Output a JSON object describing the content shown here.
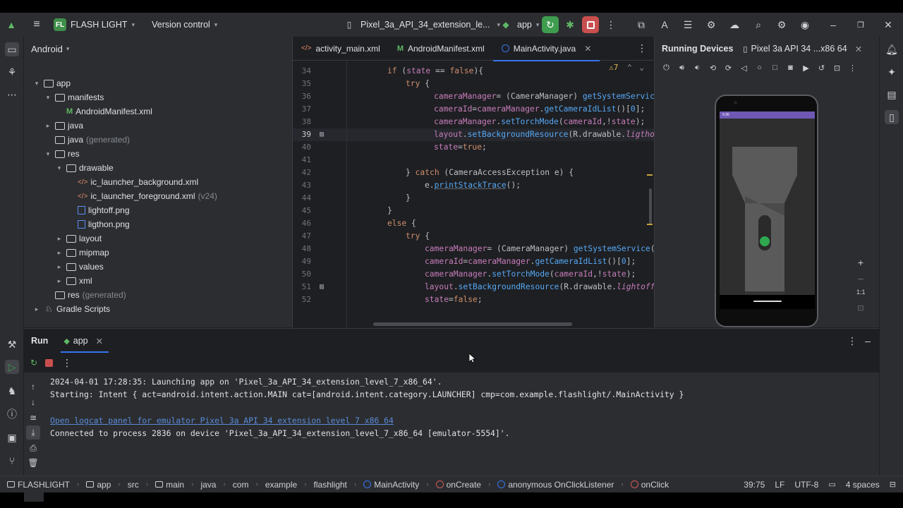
{
  "titlebar": {
    "project_badge": "FL",
    "project_name": "FLASH LIGHT",
    "vcs": "Version control",
    "device": "Pixel_3a_API_34_extension_le...",
    "run_config": "app"
  },
  "project_panel": {
    "view_mode": "Android",
    "tree": [
      {
        "label": "app",
        "suffix": ""
      },
      {
        "label": "manifests",
        "suffix": ""
      },
      {
        "label": "AndroidManifest.xml",
        "suffix": ""
      },
      {
        "label": "java",
        "suffix": ""
      },
      {
        "label": "java",
        "suffix": "(generated)"
      },
      {
        "label": "res",
        "suffix": ""
      },
      {
        "label": "drawable",
        "suffix": ""
      },
      {
        "label": "ic_launcher_background.xml",
        "suffix": ""
      },
      {
        "label": "ic_launcher_foreground.xml",
        "suffix": "(v24)"
      },
      {
        "label": "lightoff.png",
        "suffix": ""
      },
      {
        "label": "ligthon.png",
        "suffix": ""
      },
      {
        "label": "layout",
        "suffix": ""
      },
      {
        "label": "mipmap",
        "suffix": ""
      },
      {
        "label": "values",
        "suffix": ""
      },
      {
        "label": "xml",
        "suffix": ""
      },
      {
        "label": "res",
        "suffix": "(generated)"
      },
      {
        "label": "Gradle Scripts",
        "suffix": ""
      }
    ]
  },
  "editor": {
    "tabs": [
      "activity_main.xml",
      "AndroidManifest.xml",
      "MainActivity.java"
    ],
    "warnings": "7",
    "lines": [
      {
        "n": "34",
        "t": "if (state == false){"
      },
      {
        "n": "35",
        "t": "try {"
      },
      {
        "n": "36",
        "t": "cameraManager= (CameraManager) getSystemService"
      },
      {
        "n": "37",
        "t": "cameraId=cameraManager.getCameraIdList()[0];"
      },
      {
        "n": "38",
        "t": "cameraManager.setTorchMode(cameraId,!state);"
      },
      {
        "n": "39",
        "t": "layout.setBackgroundResource(R.drawable.ligthon"
      },
      {
        "n": "40",
        "t": "state=true;"
      },
      {
        "n": "41",
        "t": ""
      },
      {
        "n": "42",
        "t": "} catch (CameraAccessException e) {"
      },
      {
        "n": "43",
        "t": "e.printStackTrace();"
      },
      {
        "n": "44",
        "t": "}"
      },
      {
        "n": "45",
        "t": "}"
      },
      {
        "n": "46",
        "t": "else {"
      },
      {
        "n": "47",
        "t": "try {"
      },
      {
        "n": "48",
        "t": "cameraManager= (CameraManager) getSystemService("
      },
      {
        "n": "49",
        "t": "cameraId=cameraManager.getCameraIdList()[0];"
      },
      {
        "n": "50",
        "t": "cameraManager.setTorchMode(cameraId,!state);"
      },
      {
        "n": "51",
        "t": "layout.setBackgroundResource(R.drawable.lightoff)"
      },
      {
        "n": "52",
        "t": "state=false;"
      }
    ]
  },
  "devices": {
    "title": "Running Devices",
    "device_tab": "Pixel 3a API 34 ...x86 64",
    "status_time": "5:36",
    "zoom_label": "1:1"
  },
  "run": {
    "title": "Run",
    "config_tab": "app",
    "console": [
      "2024-04-01 17:28:35: Launching app on 'Pixel_3a_API_34_extension_level_7_x86_64'.",
      "Starting: Intent { act=android.intent.action.MAIN cat=[android.intent.category.LAUNCHER] cmp=com.example.flashlight/.MainActivity }",
      "Open logcat panel for emulator Pixel 3a API 34 extension level 7 x86 64",
      "Connected to process 2836 on device 'Pixel_3a_API_34_extension_level_7_x86_64 [emulator-5554]'."
    ]
  },
  "statusbar": {
    "breadcrumbs": [
      "FLASHLIGHT",
      "app",
      "src",
      "main",
      "java",
      "com",
      "example",
      "flashlight",
      "MainActivity",
      "onCreate",
      "anonymous OnClickListener",
      "onClick"
    ],
    "position": "39:75",
    "line_sep": "LF",
    "encoding": "UTF-8",
    "indent": "4 spaces"
  },
  "colors": {
    "accent": "#3574f0",
    "run_green": "#3e9c4f",
    "stop_red": "#c94f4f",
    "phone_status": "#6f58b4",
    "flashlight_knob": "#2fa84f"
  }
}
